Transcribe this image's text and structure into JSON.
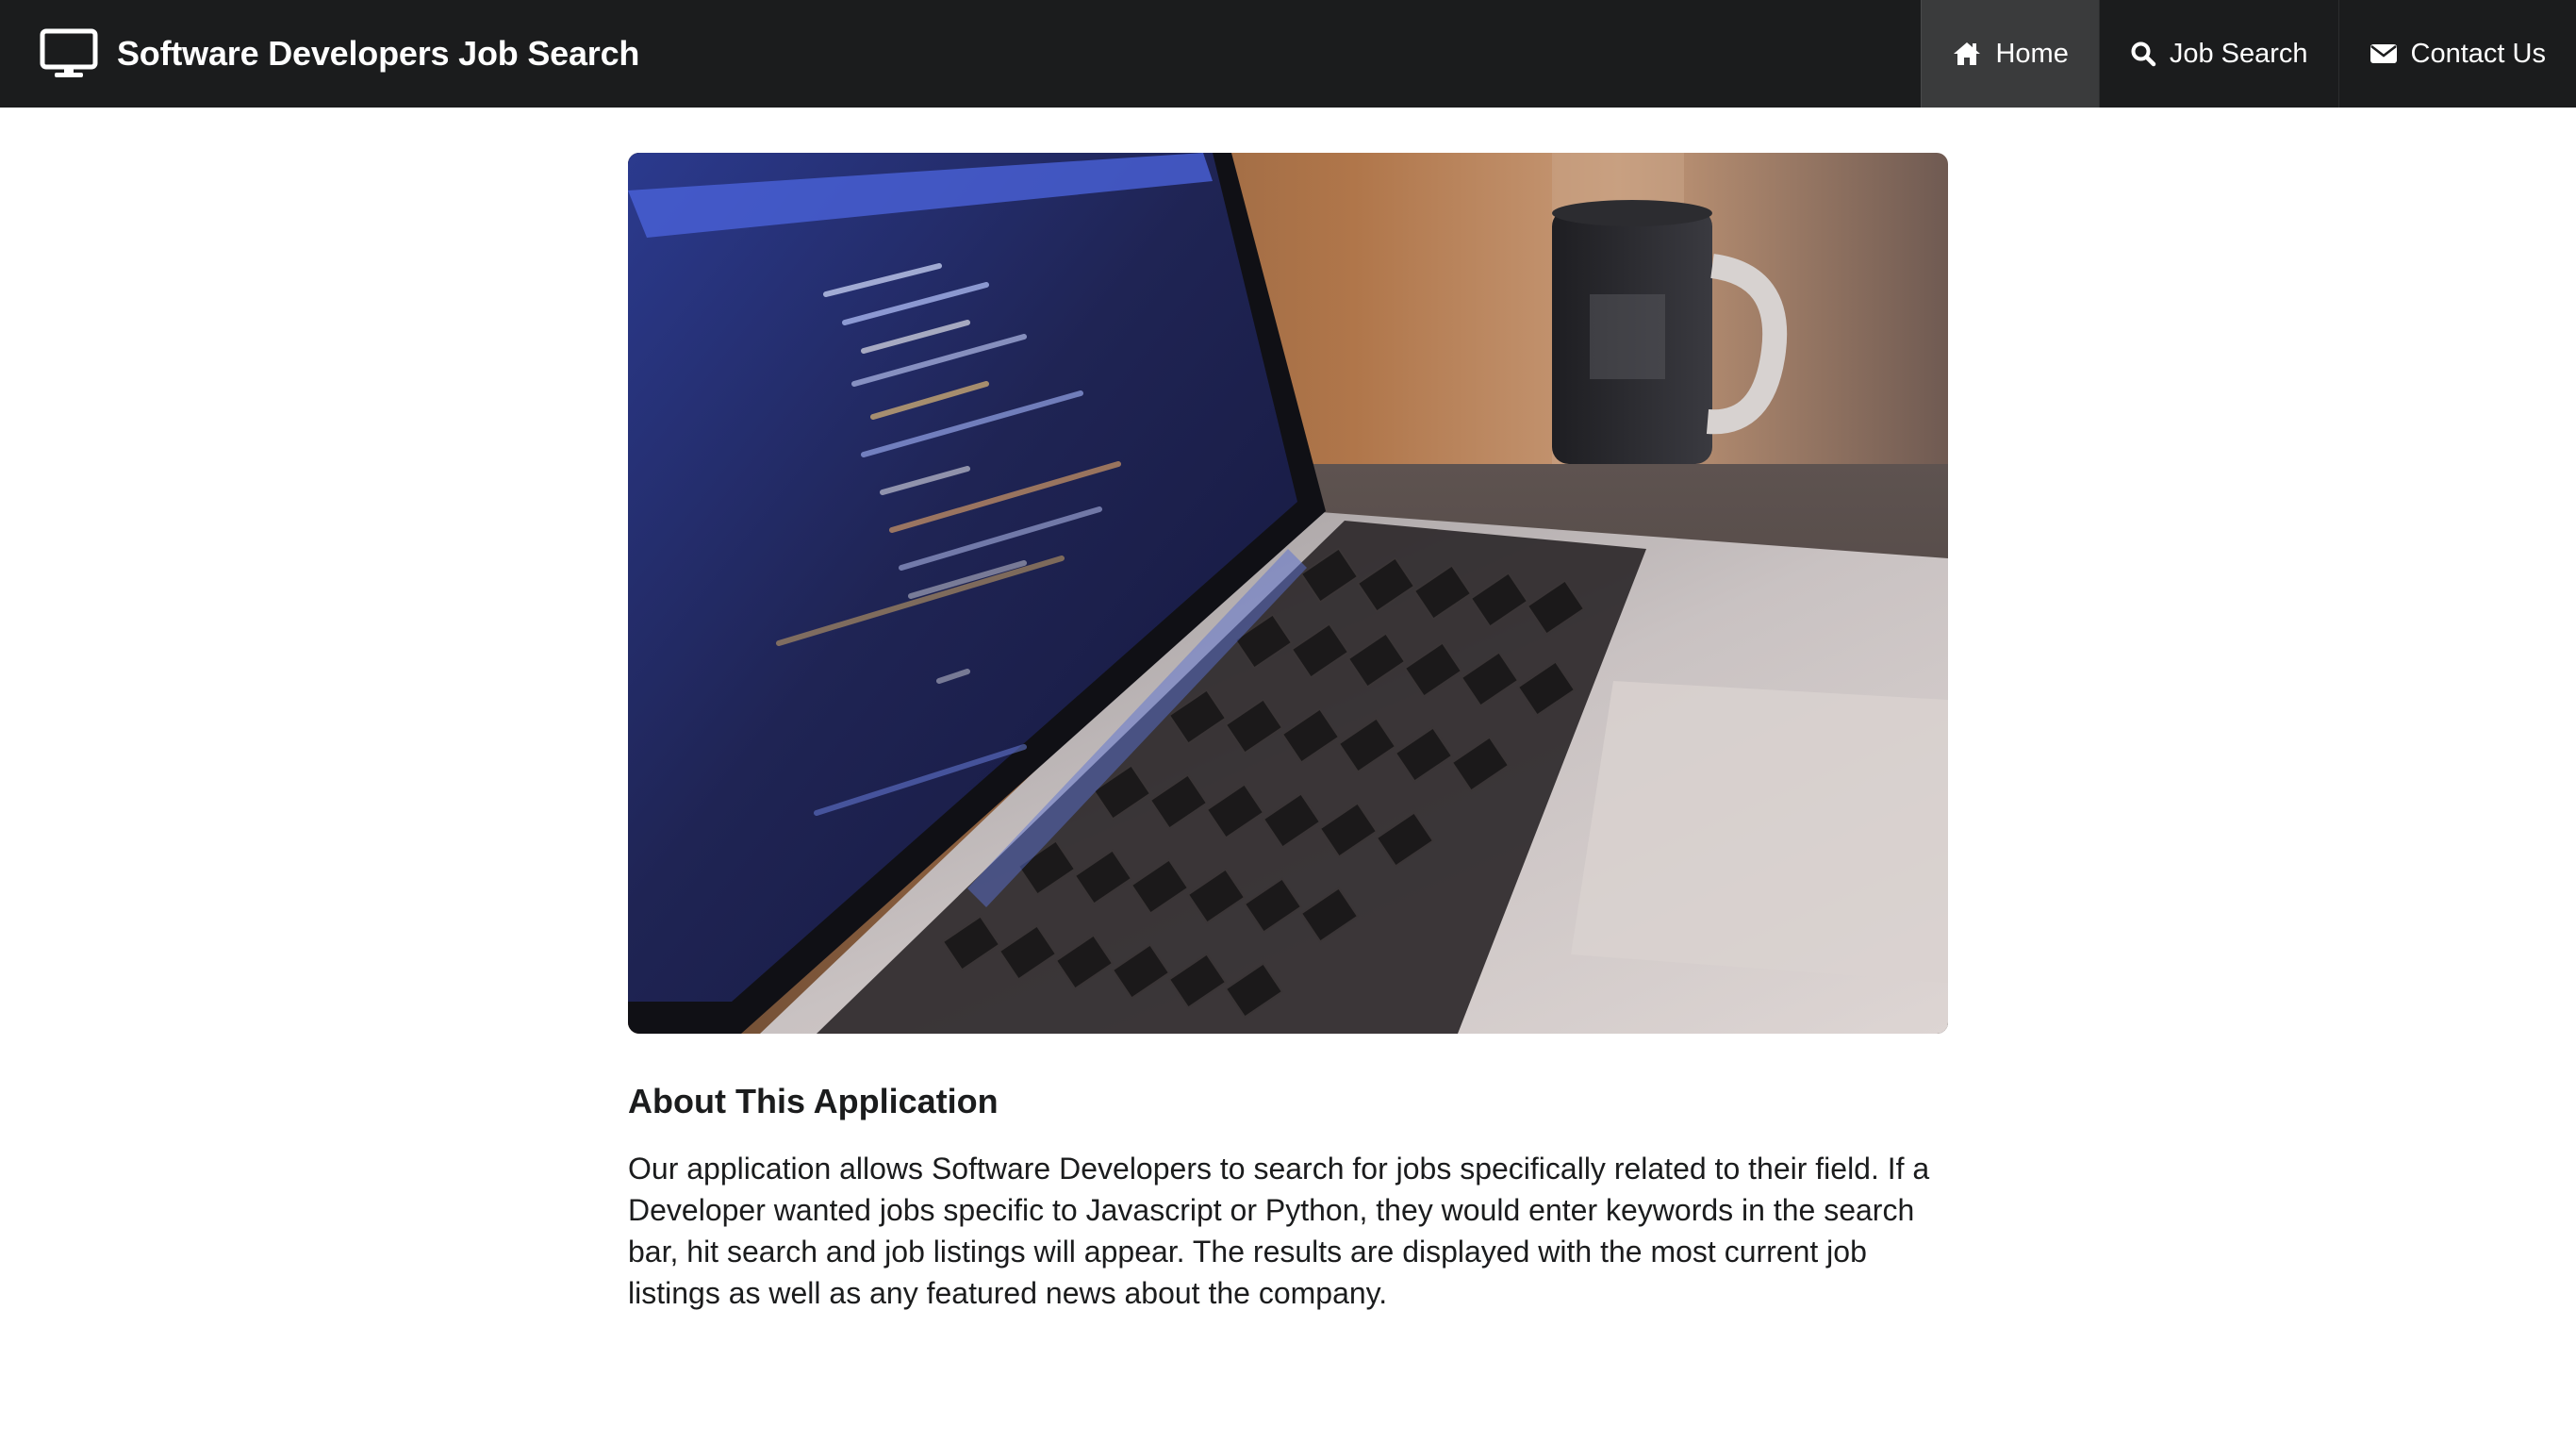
{
  "header": {
    "title": "Software Developers Job Search",
    "logo_icon": "desktop-monitor-icon"
  },
  "nav": {
    "items": [
      {
        "label": "Home",
        "icon": "home-icon",
        "active": true
      },
      {
        "label": "Job Search",
        "icon": "search-icon",
        "active": false
      },
      {
        "label": "Contact Us",
        "icon": "envelope-icon",
        "active": false
      }
    ]
  },
  "hero": {
    "image_subject": "laptop-code-photo"
  },
  "about": {
    "heading": "About This Application",
    "body": "Our application allows Software Developers to search for jobs specifically related to their field. If a Developer wanted jobs specific to Javascript or Python, they would enter keywords in the search bar, hit search and job listings will appear. The results are displayed with the most current job listings as well as any featured news about the company."
  },
  "colors": {
    "navbar_bg": "#1b1c1d",
    "nav_active_bg": "#3a3b3c",
    "text": "#1b1c1d"
  }
}
